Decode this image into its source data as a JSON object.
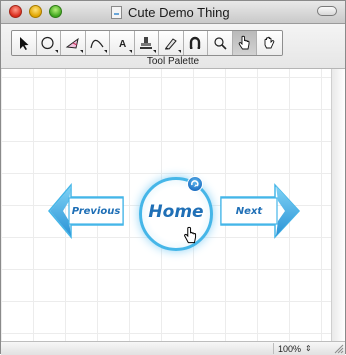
{
  "window": {
    "title": "Cute Demo Thing"
  },
  "palette": {
    "label": "Tool Palette",
    "tools": [
      {
        "icon": "arrow-select-icon",
        "selected": false
      },
      {
        "icon": "ellipse-icon",
        "selected": false
      },
      {
        "icon": "polygon-icon",
        "selected": false
      },
      {
        "icon": "curve-icon",
        "selected": false
      },
      {
        "icon": "text-tool-icon",
        "label": "A",
        "selected": false
      },
      {
        "icon": "stamp-icon",
        "selected": false
      },
      {
        "icon": "eraser-pen-icon",
        "selected": false
      },
      {
        "icon": "magnet-icon",
        "selected": false
      },
      {
        "icon": "magnifier-icon",
        "selected": false
      },
      {
        "icon": "pointing-hand-icon",
        "selected": true
      },
      {
        "icon": "grab-hand-icon",
        "selected": false
      }
    ]
  },
  "canvas": {
    "previous_label": "Previous",
    "home_label": "Home",
    "next_label": "Next",
    "accent_color": "#45b6e8",
    "text_color": "#1f6fb6"
  },
  "statusbar": {
    "zoom": "100%"
  }
}
